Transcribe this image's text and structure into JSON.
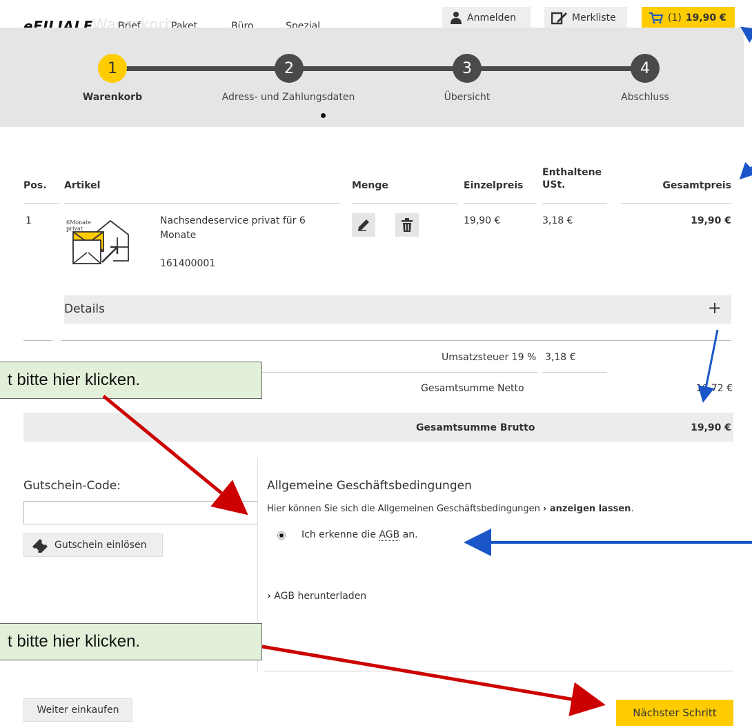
{
  "header": {
    "logo": "eFILIALE",
    "logo_ghost": "Warenkorb",
    "nav": [
      "Brief",
      "Paket",
      "Büro",
      "Spezial"
    ],
    "login_label": "Anmelden",
    "wishlist_label": "Merkliste",
    "cart_count": "(1)",
    "cart_total": "19,90 €"
  },
  "steps": [
    {
      "num": "1",
      "label": "Warenkorb"
    },
    {
      "num": "2",
      "label": "Adress- und Zahlungsdaten"
    },
    {
      "num": "3",
      "label": "Übersicht"
    },
    {
      "num": "4",
      "label": "Abschluss"
    }
  ],
  "table": {
    "headers": {
      "pos": "Pos.",
      "article": "Artikel",
      "qty": "Menge",
      "unit_price": "Einzelpreis",
      "vat_line1": "Enthaltene",
      "vat_line2": "USt.",
      "total": "Gesamtpreis"
    },
    "rows": [
      {
        "pos": "1",
        "thumb_text_1": "6Monate",
        "thumb_text_2": "privat",
        "name_line1": "Nachsendeservice privat für 6",
        "name_line2": "Monate",
        "article_no": "161400001",
        "unit_price": "19,90 €",
        "vat": "3,18 €",
        "total": "19,90 €"
      }
    ],
    "details_label": "Details",
    "details_toggle": "+"
  },
  "summary": {
    "vat_label": "Umsatzsteuer 19 %",
    "vat_value": "3,18 €",
    "net_label": "Gesamtsumme Netto",
    "net_value": "16,72 €",
    "gross_label": "Gesamtsumme Brutto",
    "gross_value": "19,90 €"
  },
  "voucher": {
    "label": "Gutschein-Code:",
    "value": "",
    "button": "Gutschein einlösen"
  },
  "agb": {
    "title": "Allgemeine Geschäftsbedingungen",
    "text": "Hier können Sie sich die Allgemeinen Geschäftsbedingungen",
    "show_link": "anzeigen lassen",
    "checkbox_pre": "Ich erkenne die",
    "checkbox_abbr": "AGB",
    "checkbox_post": "an.",
    "download_link": "AGB herunterladen"
  },
  "annotations": {
    "callout_1": "t bitte hier klicken.",
    "callout_2": "t bitte hier klicken.",
    "red_arrow_color": "#cc0000",
    "blue_arrow_color": "#1a56c8"
  },
  "footer": {
    "continue_shopping": "Weiter einkaufen",
    "next_step": "Nächster Schritt"
  },
  "colors": {
    "accent": "#ffcc00",
    "step_dark": "#4a4a4a",
    "step_bar_bg": "#e5e5e5",
    "callout_bg": "#e2f0d9"
  }
}
